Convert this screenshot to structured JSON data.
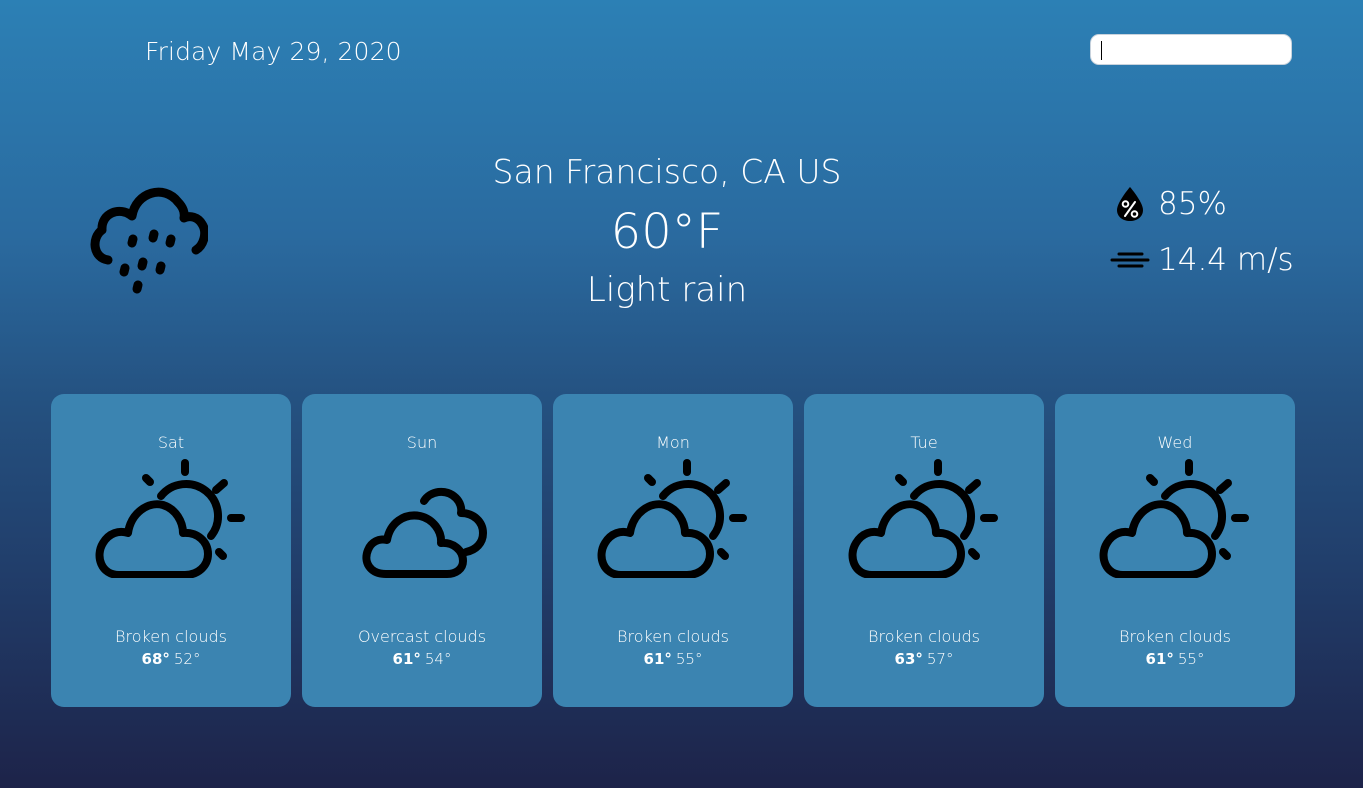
{
  "date": "Friday May 29, 2020",
  "search": {
    "value": "",
    "placeholder": ""
  },
  "current": {
    "location": "San Francisco, CA US",
    "temperature": "60°F",
    "condition": "Light rain",
    "icon": "cloud-rain-icon",
    "humidity": "85%",
    "humidity_icon": "humidity-drop-icon",
    "wind": "14.4 m/s",
    "wind_icon": "wind-icon"
  },
  "forecast": [
    {
      "day": "Sat",
      "description": "Broken clouds",
      "high": "68°",
      "low": "52°",
      "icon": "sun-cloud-icon"
    },
    {
      "day": "Sun",
      "description": "Overcast clouds",
      "high": "61°",
      "low": "54°",
      "icon": "clouds-icon"
    },
    {
      "day": "Mon",
      "description": "Broken clouds",
      "high": "61°",
      "low": "55°",
      "icon": "sun-cloud-icon"
    },
    {
      "day": "Tue",
      "description": "Broken clouds",
      "high": "63°",
      "low": "57°",
      "icon": "sun-cloud-icon"
    },
    {
      "day": "Wed",
      "description": "Broken clouds",
      "high": "61°",
      "low": "55°",
      "icon": "sun-cloud-icon"
    }
  ],
  "colors": {
    "gradient_top": "#2c80b5",
    "gradient_bottom": "#1d2349",
    "card": "#3b84b1",
    "text": "#ffffff"
  }
}
